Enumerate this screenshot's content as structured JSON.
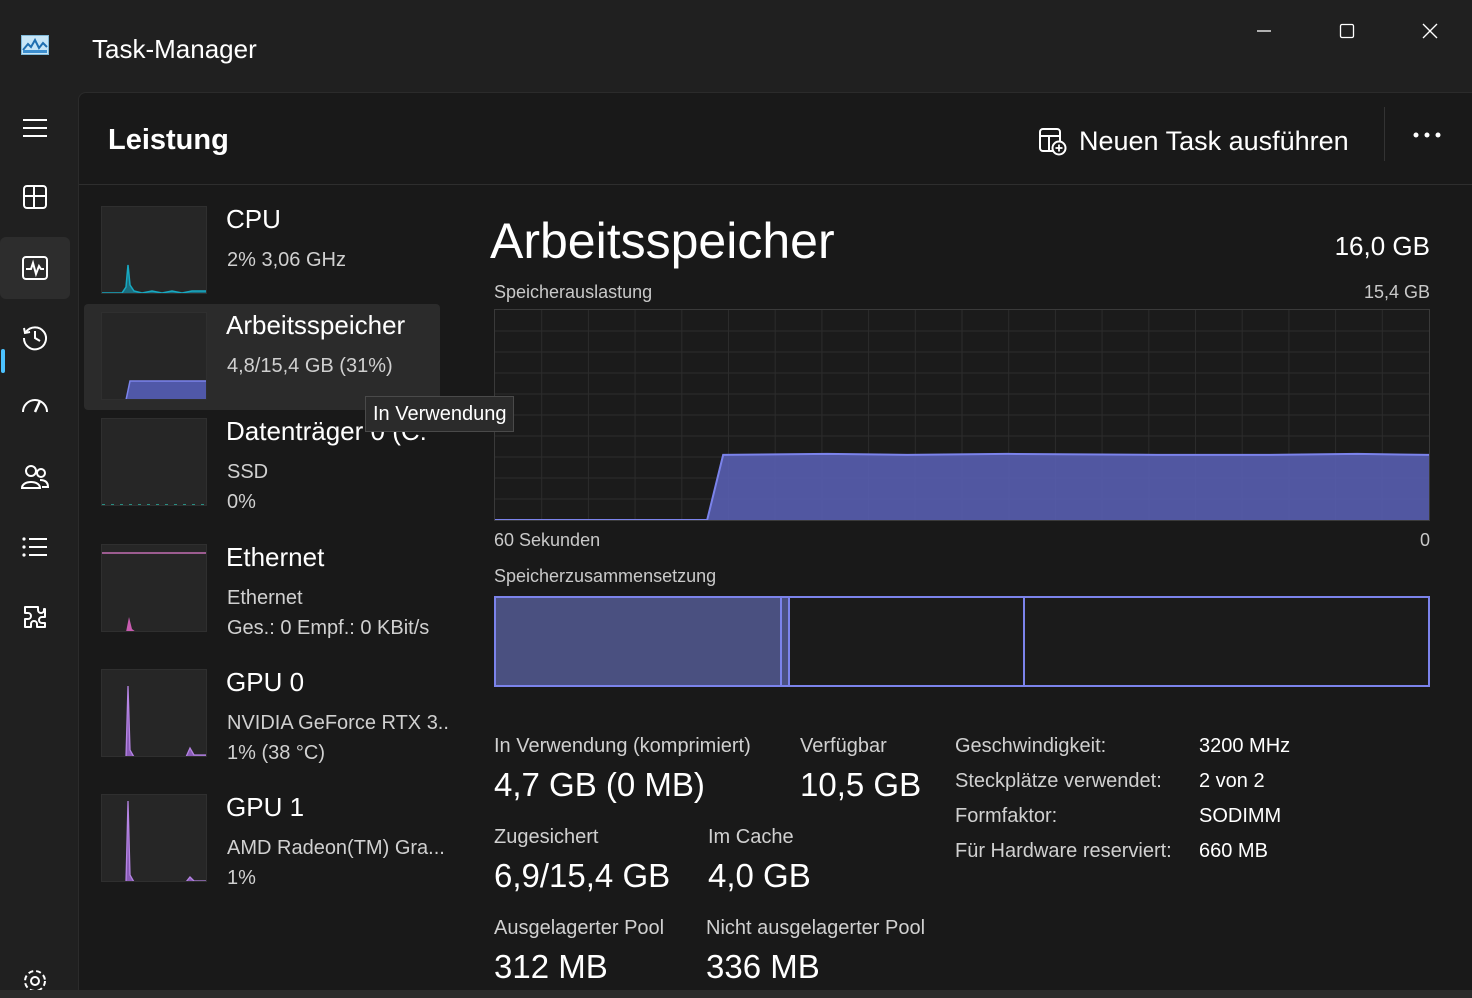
{
  "window": {
    "title": "Task-Manager",
    "controls": {
      "minimize": "minimize",
      "maximize": "maximize",
      "close": "close"
    }
  },
  "nav": {
    "items": [
      {
        "name": "menu-icon"
      },
      {
        "name": "processes-icon"
      },
      {
        "name": "performance-icon",
        "active": true
      },
      {
        "name": "app-history-icon"
      },
      {
        "name": "startup-apps-icon"
      },
      {
        "name": "users-icon"
      },
      {
        "name": "details-icon"
      },
      {
        "name": "services-icon"
      }
    ],
    "settings": "settings-gear-icon"
  },
  "header": {
    "title": "Leistung",
    "run_task_label": "Neuen Task ausführen",
    "more_label": "..."
  },
  "resources": [
    {
      "name": "CPU",
      "sub1": "2%  3,06 GHz",
      "sub2": "",
      "color": "#17a9c2"
    },
    {
      "name": "Arbeitsspeicher",
      "sub1": "4,8/15,4 GB (31%)",
      "sub2": "",
      "color": "#7b83eb",
      "selected": true
    },
    {
      "name": "Datenträger 0 (C:",
      "sub1": "SSD",
      "sub2": "0%",
      "color": "#2ab0a0"
    },
    {
      "name": "Ethernet",
      "sub1": "Ethernet",
      "sub2": "Ges.: 0  Empf.: 0 KBit/s",
      "color": "#e47ed0"
    },
    {
      "name": "GPU 0",
      "sub1": "NVIDIA GeForce RTX 3..",
      "sub2": "1%  (38 °C)",
      "color": "#b584e3"
    },
    {
      "name": "GPU 1",
      "sub1": "AMD Radeon(TM) Gra...",
      "sub2": "1%",
      "color": "#b584e3"
    }
  ],
  "tooltip": "In Verwendung",
  "detail": {
    "title": "Arbeitsspeicher",
    "total": "16,0 GB",
    "usage_label": "Speicherauslastung",
    "usage_max": "15,4 GB",
    "time_label": "60 Sekunden",
    "time_min": "0",
    "composition_label": "Speicherzusammensetzung",
    "usage_graph": {
      "start_fraction": 0.24,
      "level_fraction": 0.31,
      "color": "#7b83eb"
    }
  },
  "stats": {
    "in_use_label": "In Verwendung (komprimiert)",
    "in_use_value": "4,7 GB (0 MB)",
    "available_label": "Verfügbar",
    "available_value": "10,5 GB",
    "committed_label": "Zugesichert",
    "committed_value": "6,9/15,4 GB",
    "cached_label": "Im Cache",
    "cached_value": "4,0 GB",
    "paged_label": "Ausgelagerter Pool",
    "paged_value": "312 MB",
    "nonpaged_label": "Nicht ausgelagerter Pool",
    "nonpaged_value": "336 MB"
  },
  "properties": [
    {
      "label": "Geschwindigkeit:",
      "value": "3200 MHz"
    },
    {
      "label": "Steckplätze verwendet:",
      "value": "2 von 2"
    },
    {
      "label": "Formfaktor:",
      "value": "SODIMM"
    },
    {
      "label": "Für Hardware reserviert:",
      "value": "660 MB"
    }
  ]
}
